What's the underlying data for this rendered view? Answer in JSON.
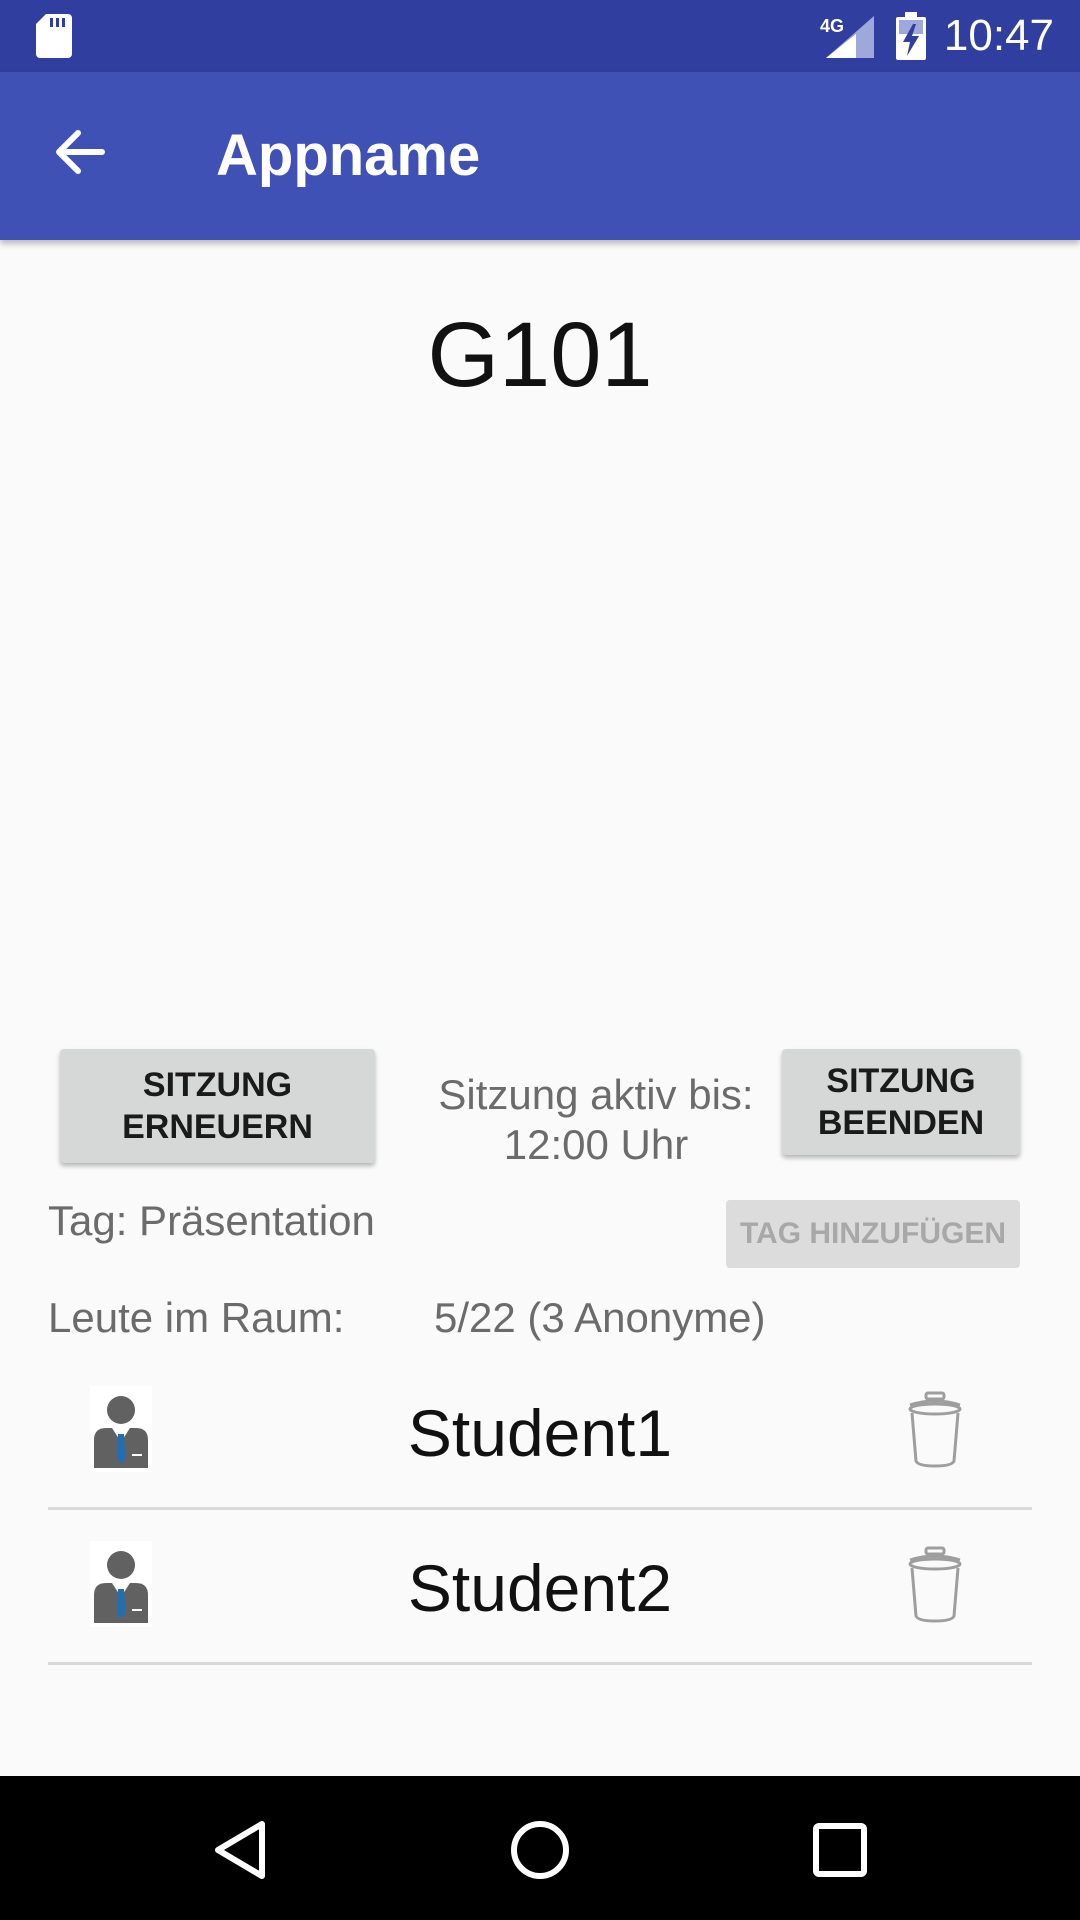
{
  "status_bar": {
    "network": "4G",
    "time": "10:47"
  },
  "app_bar": {
    "title": "Appname"
  },
  "room": {
    "name": "G101"
  },
  "session": {
    "renew_label_line1": "SITZUNG",
    "renew_label_line2": "ERNEUERN",
    "end_label_line1": "SITZUNG",
    "end_label_line2": "BEENDEN",
    "active_label": "Sitzung aktiv bis:",
    "active_until": "12:00 Uhr"
  },
  "tag": {
    "label": "Tag: Präsentation",
    "add_button": "TAG HINZUFÜGEN"
  },
  "people": {
    "label": "Leute im Raum:",
    "count": "5/22 (3 Anonyme)"
  },
  "students": [
    {
      "name": "Student1"
    },
    {
      "name": "Student2"
    }
  ],
  "colors": {
    "status_bar": "#303f9f",
    "app_bar": "#3f51b5",
    "background": "#fafafa"
  },
  "icons": {
    "back": "arrow-left-icon",
    "avatar": "person-avatar-icon",
    "delete": "trash-icon"
  }
}
